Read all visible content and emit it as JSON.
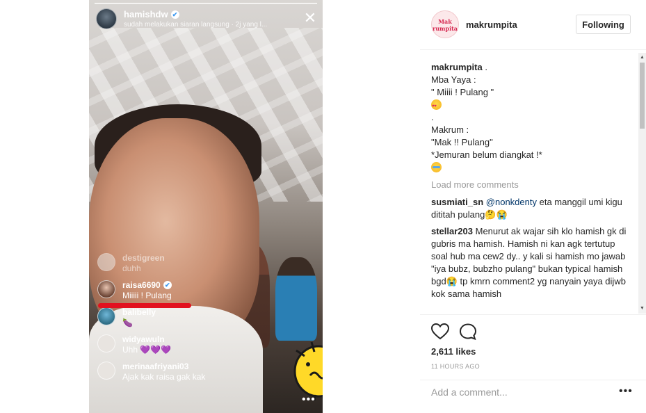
{
  "story": {
    "username": "hamishdw",
    "subtitle": "sudah melakukan siaran langsung · 2j yang l...",
    "comments": [
      {
        "user": "destigreen",
        "text": "duhh",
        "faded": true,
        "verified": false
      },
      {
        "user": "raisa6690",
        "text": "Miiiii ! Pulang",
        "faded": false,
        "verified": true
      },
      {
        "user": "balibelly",
        "text": "🍆",
        "faded": false,
        "verified": false
      },
      {
        "user": "widyawuln",
        "text": "Uhh 💜💜💜",
        "faded": false,
        "verified": false
      },
      {
        "user": "merinaafriyani03",
        "text": "Ajak kak raisa gak kak",
        "faded": false,
        "verified": false
      }
    ],
    "more_label": "•••"
  },
  "post": {
    "owner": "makrumpita",
    "owner_avatar_text": "Mak rumpita",
    "follow_label": "Following",
    "caption": {
      "user": "makrumpita",
      "lines": [
        ".",
        "Mba Yaya :",
        "\" Miiii ! Pulang \"",
        "",
        ".",
        "Makrum :",
        "\"Mak !! Pulang\"",
        "*Jemuran belum diangkat !*",
        ""
      ]
    },
    "load_more": "Load more comments",
    "comments": [
      {
        "user": "susmiati_sn",
        "mention": "@nonkdenty",
        "text": " eta manggil umi kigu dititah pulang🤔😭"
      },
      {
        "user": "stellar203",
        "mention": "",
        "text": " Menurut ak wajar sih klo hamish gk di gubris ma hamish. Hamish ni kan agk tertutup soal hub ma cew2 dy.. y kali si hamish mo jawab \"iya bubz, bubzho pulang\" bukan typical hamish bgd😭 tp kmrn comment2 yg nanyain yaya dijwb kok sama hamish"
      }
    ],
    "likes": "2,611 likes",
    "time": "11 HOURS AGO",
    "add_comment_placeholder": "Add a comment...",
    "more_options": "•••"
  },
  "colors": {
    "accent_red": "#e2111f",
    "link_blue": "#003569",
    "verified_blue": "#3897f0"
  }
}
